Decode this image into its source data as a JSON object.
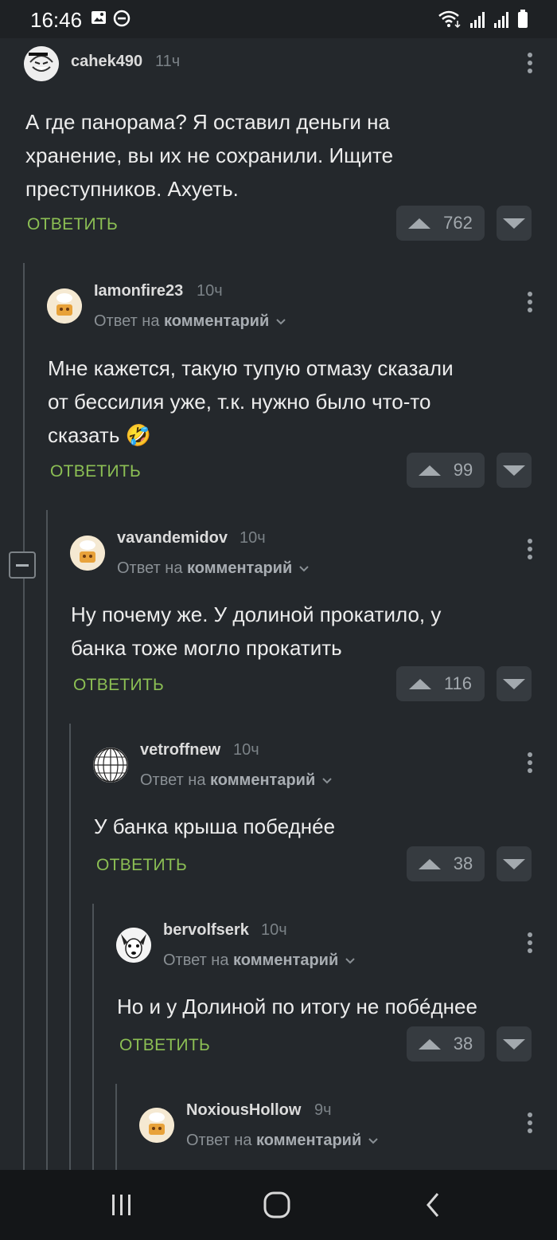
{
  "status_bar": {
    "time": "16:46",
    "left_icons": [
      "gallery-icon",
      "do-not-disturb-icon"
    ],
    "right_icons": [
      "wifi-icon",
      "signal-icon",
      "signal-icon",
      "battery-icon"
    ]
  },
  "reply_prefix": "Ответ на",
  "reply_target": "комментарий",
  "reply_button": "ОТВЕТИТЬ",
  "comments": [
    {
      "user": "cahek490",
      "time": "11ч",
      "text_lines": [
        "А где панорама? Я оставил деньги на",
        "хранение, вы их не сохранили. Ищите",
        "преступников. Ахуеть."
      ],
      "votes": "762",
      "avatar": "trollface-avatar"
    },
    {
      "user": "Iamonfire23",
      "time": "10ч",
      "text_lines": [
        "Мне кажется, такую тупую отмазу сказали",
        "от бессилия уже, т.к. нужно было что-то",
        "сказать 🤣"
      ],
      "votes": "99",
      "avatar": "chef-avatar"
    },
    {
      "user": "vavandemidov",
      "time": "10ч",
      "text_lines": [
        "Ну почему же. У долиной прокатило, у",
        "банка тоже могло прокатить"
      ],
      "votes": "116",
      "avatar": "chef-avatar"
    },
    {
      "user": "vetroffnew",
      "time": "10ч",
      "text_lines": [
        "У банка крыша победнéе"
      ],
      "votes": "38",
      "avatar": "globe-avatar"
    },
    {
      "user": "bervolfserk",
      "time": "10ч",
      "text_lines": [
        "Но и у Долиной по итогу не побéднее"
      ],
      "votes": "38",
      "avatar": "dog-avatar"
    },
    {
      "user": "NoxiousHollow",
      "time": "9ч",
      "text_lines": [],
      "votes": "",
      "avatar": "chef-avatar"
    }
  ],
  "nav": [
    "recent-apps-icon",
    "home-icon",
    "back-icon"
  ],
  "colors": {
    "background": "#24282c",
    "accent_green": "#8cbf54",
    "vote_bg": "#363b40"
  }
}
